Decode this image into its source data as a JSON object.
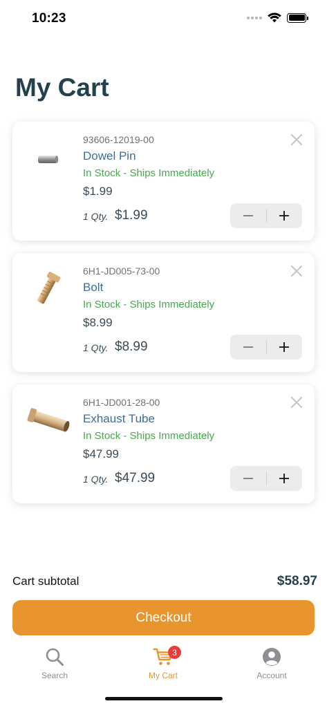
{
  "status_bar": {
    "time": "10:23"
  },
  "page": {
    "title": "My Cart"
  },
  "cart": {
    "items": [
      {
        "sku": "93606-12019-00",
        "name": "Dowel Pin",
        "stock": "In Stock - Ships Immediately",
        "price": "$1.99",
        "qty_label": "1 Qty.",
        "line_total": "$1.99"
      },
      {
        "sku": "6H1-JD005-73-00",
        "name": "Bolt",
        "stock": "In Stock - Ships Immediately",
        "price": "$8.99",
        "qty_label": "1 Qty.",
        "line_total": "$8.99"
      },
      {
        "sku": "6H1-JD001-28-00",
        "name": "Exhaust Tube",
        "stock": "In Stock - Ships Immediately",
        "price": "$47.99",
        "qty_label": "1 Qty.",
        "line_total": "$47.99"
      }
    ],
    "subtotal_label": "Cart subtotal",
    "subtotal_value": "$58.97",
    "checkout_label": "Checkout"
  },
  "tab_bar": {
    "tabs": [
      {
        "label": "Search",
        "icon": "search-icon",
        "color": "#8e8e93"
      },
      {
        "label": "My Cart",
        "icon": "cart-icon",
        "color": "#e8952f",
        "badge": "3"
      },
      {
        "label": "Account",
        "icon": "account-icon",
        "color": "#8e8e93"
      }
    ]
  },
  "colors": {
    "accent": "#e8952f",
    "title": "#24404f",
    "link": "#3f6d96",
    "in_stock": "#46a84f",
    "badge": "#ec3b3b"
  }
}
